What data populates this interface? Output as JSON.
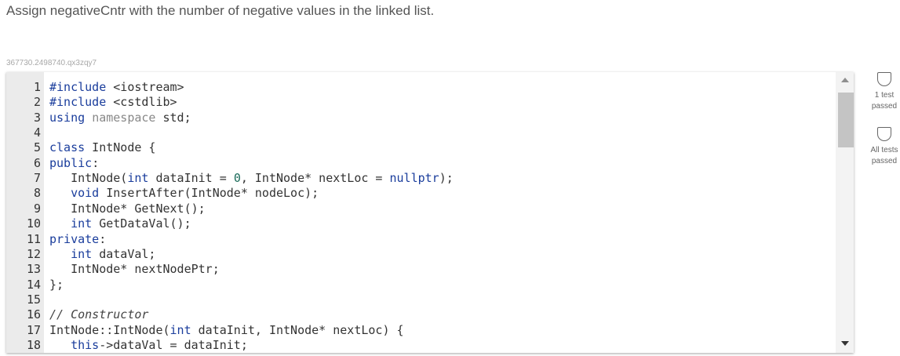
{
  "prompt": "Assign negativeCntr with the number of negative values in the linked list.",
  "challenge_id": "367730.2498740.qx3zqy7",
  "code_lines": [
    {
      "n": "1",
      "text": "#include <iostream>"
    },
    {
      "n": "2",
      "text": "#include <cstdlib>"
    },
    {
      "n": "3",
      "text": "using namespace std;"
    },
    {
      "n": "4",
      "text": ""
    },
    {
      "n": "5",
      "text": "class IntNode {"
    },
    {
      "n": "6",
      "text": "public:"
    },
    {
      "n": "7",
      "text": "   IntNode(int dataInit = 0, IntNode* nextLoc = nullptr);"
    },
    {
      "n": "8",
      "text": "   void InsertAfter(IntNode* nodeLoc);"
    },
    {
      "n": "9",
      "text": "   IntNode* GetNext();"
    },
    {
      "n": "10",
      "text": "   int GetDataVal();"
    },
    {
      "n": "11",
      "text": "private:"
    },
    {
      "n": "12",
      "text": "   int dataVal;"
    },
    {
      "n": "13",
      "text": "   IntNode* nextNodePtr;"
    },
    {
      "n": "14",
      "text": "};"
    },
    {
      "n": "15",
      "text": ""
    },
    {
      "n": "16",
      "text": "// Constructor"
    },
    {
      "n": "17",
      "text": "IntNode::IntNode(int dataInit, IntNode* nextLoc) {"
    },
    {
      "n": "18",
      "text": "   this->dataVal = dataInit;"
    }
  ],
  "tests": [
    {
      "line1": "1 test",
      "line2": "passed"
    },
    {
      "line1": "All tests",
      "line2": "passed"
    }
  ],
  "scrollbar": {
    "position": 0.0,
    "visible_fraction": 0.2
  },
  "colors": {
    "keyword": "#1a3d9c",
    "number": "#1b6b5a",
    "gutter": "#ebebeb"
  }
}
